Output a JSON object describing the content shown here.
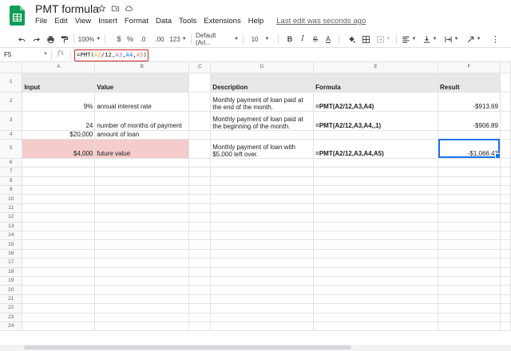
{
  "title": {
    "doc_name": "PMT formula",
    "star_icon": "star-icon",
    "move_icon": "folder-move-icon",
    "cloud_icon": "cloud-status-icon"
  },
  "menu": {
    "items": [
      "File",
      "Edit",
      "View",
      "Insert",
      "Format",
      "Data",
      "Tools",
      "Extensions",
      "Help"
    ],
    "last_edit": "Last edit was seconds ago"
  },
  "toolbar": {
    "zoom": "100%",
    "currency": "$",
    "percent": "%",
    "decimal_decrease": ".0",
    "decimal_increase": ".00",
    "more_formats": "123",
    "font": "Default (Ari...",
    "font_size": "10"
  },
  "formula_bar": {
    "cell_ref": "F5",
    "fx": "fx",
    "formula": {
      "prefix": "=PMT(",
      "a2": "A2",
      "mid1": "/12,",
      "a3": "A3",
      "sep1": ",",
      "a4": "A4",
      "sep2": ",",
      "a5": "A5",
      "suffix": ")"
    }
  },
  "grid": {
    "columns": [
      "A",
      "B",
      "C",
      "D",
      "E",
      "F"
    ],
    "rows": [
      {
        "n": "1",
        "a": "Input",
        "b": "Value",
        "d": "Description",
        "e": "Formula",
        "f": "Result"
      },
      {
        "n": "2",
        "a": "9%",
        "b": "annual interest rate",
        "d": "Monthly payment of loan paid at the end of the month.",
        "e": "=PMT(A2/12,A3,A4)",
        "f": "-$913.69"
      },
      {
        "n": "3",
        "a": "24",
        "b": "number of months of payment",
        "d": "Monthly payment of loan paid at the beginning of the month.",
        "e": "=PMT(A2/12,A3,A4,,1)",
        "f": "-$906.89"
      },
      {
        "n": "4",
        "a": "$20,000",
        "b": "amount of loan",
        "d": "",
        "e": "",
        "f": ""
      },
      {
        "n": "5",
        "a": "$4,000",
        "b": "future value",
        "d": "Monthly payment of loan with $5,000 left over.",
        "e": "=PMT(A2/12,A3,A4,A5)",
        "f": "-$1,066.43"
      }
    ],
    "empty_rows": [
      "6",
      "7",
      "8",
      "9",
      "10",
      "11",
      "12",
      "13",
      "14",
      "15",
      "16",
      "17",
      "18",
      "19",
      "20",
      "21",
      "22",
      "23",
      "24"
    ]
  },
  "colors": {
    "header_shade": "#e8e8e8",
    "input_highlight": "#f4cccc",
    "selection": "#1a73e8",
    "formula_box_border": "#c62828",
    "logo_green": "#0f9d58"
  }
}
